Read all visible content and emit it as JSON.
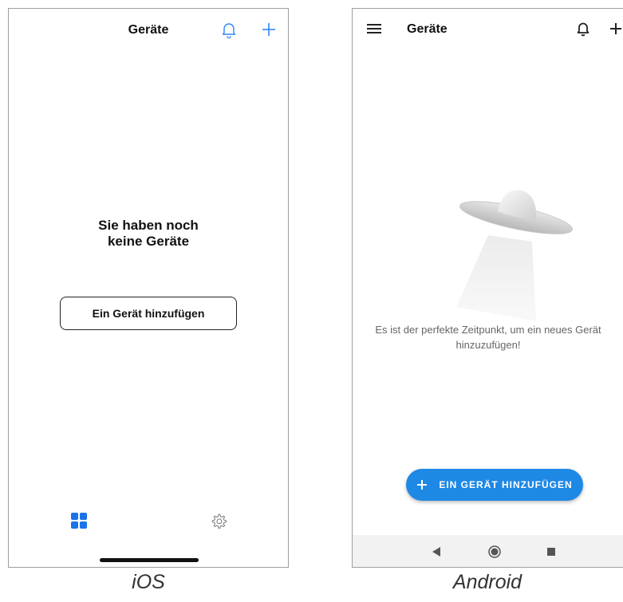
{
  "ios": {
    "title": "Geräte",
    "icons": {
      "notifications": "bell-icon",
      "add": "plus-icon",
      "tab_devices": "grid-icon",
      "tab_settings": "gear-icon"
    },
    "empty_state": {
      "line1": "Sie haben noch",
      "line2": "keine Geräte"
    },
    "add_button_label": "Ein Gerät hinzufügen"
  },
  "android": {
    "title": "Geräte",
    "icons": {
      "menu": "hamburger-menu-icon",
      "notifications": "bell-icon",
      "add": "plus-icon",
      "illustration": "ufo-illustration"
    },
    "empty_state": {
      "line1": "Es ist der perfekte Zeitpunkt, um ein neues Gerät",
      "line2": "hinzuzufügen!"
    },
    "fab_label": "EIN GERÄT HINZUFÜGEN",
    "navbar": {
      "back": "back-triangle-icon",
      "home": "home-circle-icon",
      "recents": "recents-square-icon"
    }
  },
  "captions": {
    "ios": "iOS",
    "android": "Android"
  },
  "colors": {
    "ios_accent": "#2f86f6",
    "android_fab": "#1e88e5",
    "ios_tab_active": "#1a73e8",
    "text_dark": "#111111",
    "text_muted": "#666666"
  }
}
